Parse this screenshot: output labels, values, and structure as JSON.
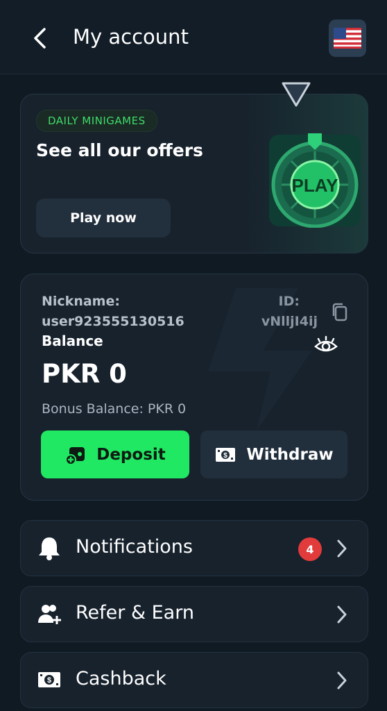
{
  "header": {
    "title": "My account"
  },
  "promo": {
    "badge": "DAILY MINIGAMES",
    "title": "See all our offers",
    "button": "Play now",
    "wheel_text": "PLAY"
  },
  "wallet": {
    "nickname_label": "Nickname:",
    "nickname_value": "user923555130516",
    "id_label": "ID:",
    "id_value": "vNlljI4ij",
    "balance_label": "Balance",
    "balance_value": "PKR 0",
    "bonus_balance": "Bonus Balance: PKR 0",
    "deposit_label": "Deposit",
    "withdraw_label": "Withdraw"
  },
  "menu": {
    "items": [
      {
        "label": "Notifications",
        "badge": "4",
        "icon": "bell-icon"
      },
      {
        "label": "Refer & Earn",
        "icon": "users-plus-icon"
      },
      {
        "label": "Cashback",
        "icon": "cash-icon"
      }
    ]
  },
  "colors": {
    "background": "#101a23",
    "card": "#17222d",
    "accent_green": "#21e862",
    "badge_red": "#e23b3b"
  }
}
